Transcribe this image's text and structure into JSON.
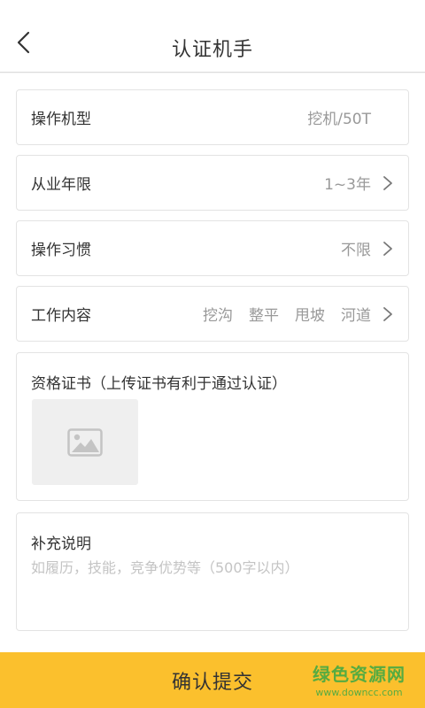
{
  "header": {
    "title": "认证机手"
  },
  "form": {
    "machine_type": {
      "label": "操作机型",
      "value": "挖机/50T"
    },
    "experience": {
      "label": "从业年限",
      "value": "1~3年"
    },
    "habit": {
      "label": "操作习惯",
      "value": "不限"
    },
    "work_content": {
      "label": "工作内容",
      "tags": [
        "挖沟",
        "整平",
        "甩坡",
        "河道"
      ]
    },
    "certificate": {
      "label": "资格证书（上传证书有利于通过认证）"
    },
    "note": {
      "label": "补充说明",
      "placeholder": "如履历，技能，竞争优势等（500字以内）"
    }
  },
  "footer": {
    "submit_label": "确认提交"
  },
  "watermark": {
    "text": "绿色资源网",
    "url": "www.downcc.com"
  },
  "colors": {
    "accent": "#fbc02d",
    "watermark": "#3aa845"
  },
  "icons": {
    "back": "chevron-left-icon",
    "arrow": "chevron-right-icon",
    "photo": "image-placeholder-icon"
  }
}
